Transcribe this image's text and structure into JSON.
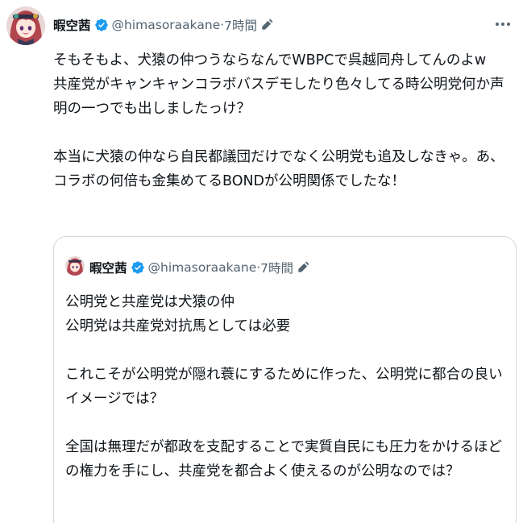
{
  "tweet": {
    "display_name": "暇空茜",
    "handle": "@himasoraakane",
    "separator": "·",
    "time": "7時間",
    "avatar_icon": "anime-girl-avatar",
    "verified_icon": "verified-badge-icon",
    "edit_icon": "edited-pencil-icon",
    "more_icon": "more-options-icon",
    "text": "そもそもよ、犬猿の仲つうならなんでWBPCで呉越同舟してんのよw\n共産党がキャンキャンコラボバスデモしたり色々してる時公明党何か声明の一つでも出しましたっけ？\n\n本当に犬猿の仲なら自民都議団だけでなく公明党も追及しなきゃ。あ、コラボの何倍も金集めてるBONDが公明関係でしたな！"
  },
  "quoted": {
    "display_name": "暇空茜",
    "handle": "@himasoraakane",
    "separator": "·",
    "time": "7時間",
    "text": "公明党と共産党は犬猿の仲\n公明党は共産党対抗馬としては必要\n\nこれこそが公明党が隠れ蓑にするために作った、公明党に都合の良いイメージでは？\n\n全国は無理だが都政を支配することで実質自民にも圧力をかけるほどの権力を手にし、共産党を都合よく使えるのが公明なのでは？"
  },
  "colors": {
    "verified_blue": "#1d9bf0",
    "muted_text": "#536471",
    "border": "#cfd9de"
  }
}
